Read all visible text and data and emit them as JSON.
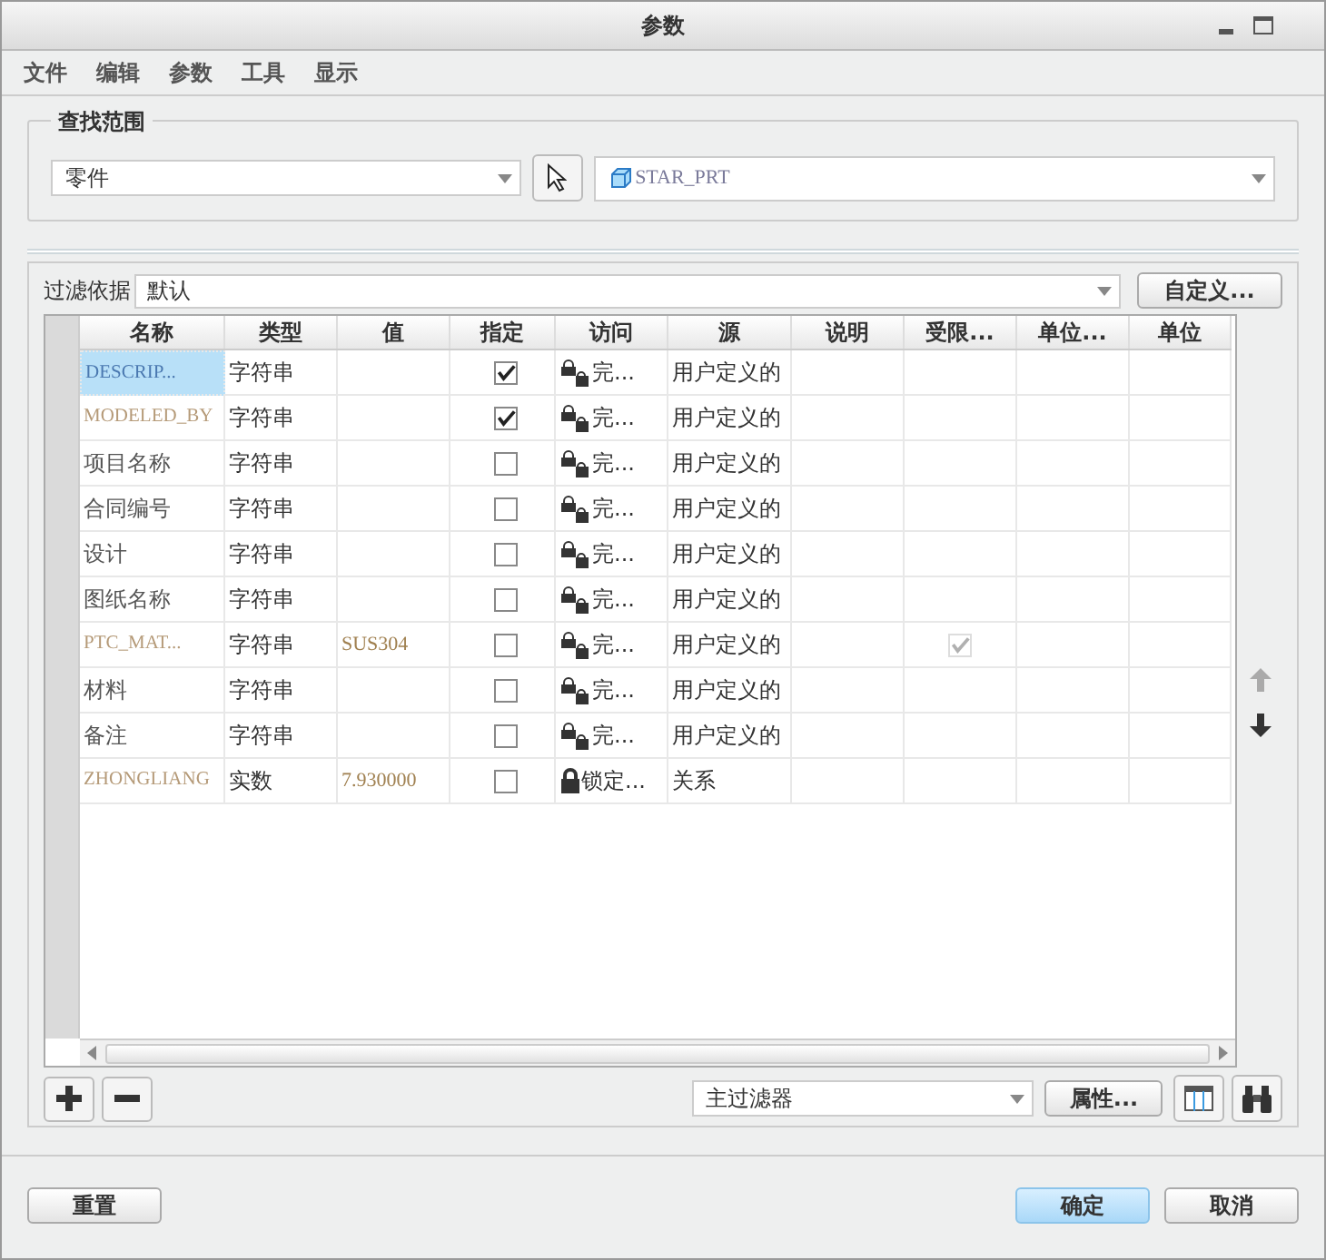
{
  "window": {
    "title": "参数"
  },
  "menu": [
    "文件",
    "编辑",
    "参数",
    "工具",
    "显示"
  ],
  "scope": {
    "legend": "查找范围",
    "type_value": "零件",
    "model_value": "STAR_PRT"
  },
  "filter": {
    "label": "过滤依据",
    "value": "默认",
    "button": "自定义..."
  },
  "table": {
    "columns": [
      "名称",
      "类型",
      "值",
      "指定",
      "访问",
      "源",
      "说明",
      "受限...",
      "单位...",
      "单位"
    ],
    "rows": [
      {
        "kind": "system",
        "selected": true,
        "name": "DESCRIP...",
        "type": "字符串",
        "value": "",
        "designated": true,
        "access": {
          "kind": "full",
          "text": "完..."
        },
        "source": "用户定义的",
        "restricted": false
      },
      {
        "kind": "system",
        "selected": false,
        "name": "MODELED_BY",
        "type": "字符串",
        "value": "",
        "designated": true,
        "access": {
          "kind": "full",
          "text": "完..."
        },
        "source": "用户定义的",
        "restricted": false
      },
      {
        "kind": "user",
        "selected": false,
        "name": "项目名称",
        "type": "字符串",
        "value": "",
        "designated": false,
        "access": {
          "kind": "full",
          "text": "完..."
        },
        "source": "用户定义的",
        "restricted": false
      },
      {
        "kind": "user",
        "selected": false,
        "name": "合同编号",
        "type": "字符串",
        "value": "",
        "designated": false,
        "access": {
          "kind": "full",
          "text": "完..."
        },
        "source": "用户定义的",
        "restricted": false
      },
      {
        "kind": "user",
        "selected": false,
        "name": "设计",
        "type": "字符串",
        "value": "",
        "designated": false,
        "access": {
          "kind": "full",
          "text": "完..."
        },
        "source": "用户定义的",
        "restricted": false
      },
      {
        "kind": "user",
        "selected": false,
        "name": "图纸名称",
        "type": "字符串",
        "value": "",
        "designated": false,
        "access": {
          "kind": "full",
          "text": "完..."
        },
        "source": "用户定义的",
        "restricted": false
      },
      {
        "kind": "system",
        "selected": false,
        "name": "PTC_MAT...",
        "type": "字符串",
        "value": "SUS304",
        "designated": false,
        "access": {
          "kind": "full",
          "text": "完..."
        },
        "source": "用户定义的",
        "restricted": true
      },
      {
        "kind": "user",
        "selected": false,
        "name": "材料",
        "type": "字符串",
        "value": "",
        "designated": false,
        "access": {
          "kind": "full",
          "text": "完..."
        },
        "source": "用户定义的",
        "restricted": false
      },
      {
        "kind": "user",
        "selected": false,
        "name": "备注",
        "type": "字符串",
        "value": "",
        "designated": false,
        "access": {
          "kind": "full",
          "text": "完..."
        },
        "source": "用户定义的",
        "restricted": false
      },
      {
        "kind": "system",
        "selected": false,
        "name": "ZHONGLIANG",
        "type": "实数",
        "value": "7.930000",
        "designated": false,
        "access": {
          "kind": "locked",
          "text": "锁定..."
        },
        "source": "关系",
        "restricted": false
      }
    ]
  },
  "toolbar": {
    "filter_value": "主过滤器",
    "properties_button": "属性..."
  },
  "footer": {
    "reset": "重置",
    "ok": "确定",
    "cancel": "取消"
  }
}
